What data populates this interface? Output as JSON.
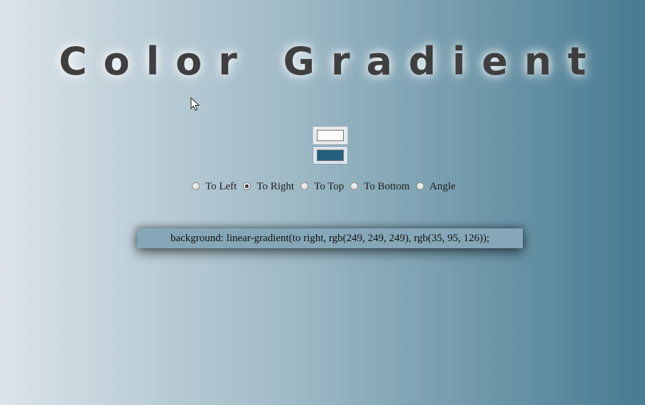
{
  "title": "Color Gradient",
  "colors": {
    "color1": "#f9f9f9",
    "color2": "#235f7e"
  },
  "direction_options": [
    {
      "label": "To Left",
      "checked": false
    },
    {
      "label": "To Right",
      "checked": true
    },
    {
      "label": "To Top",
      "checked": false
    },
    {
      "label": "To Bottom",
      "checked": false
    },
    {
      "label": "Angle",
      "checked": false
    }
  ],
  "css_output": "background: linear-gradient(to right, rgb(249, 249, 249), rgb(35, 95, 126));"
}
